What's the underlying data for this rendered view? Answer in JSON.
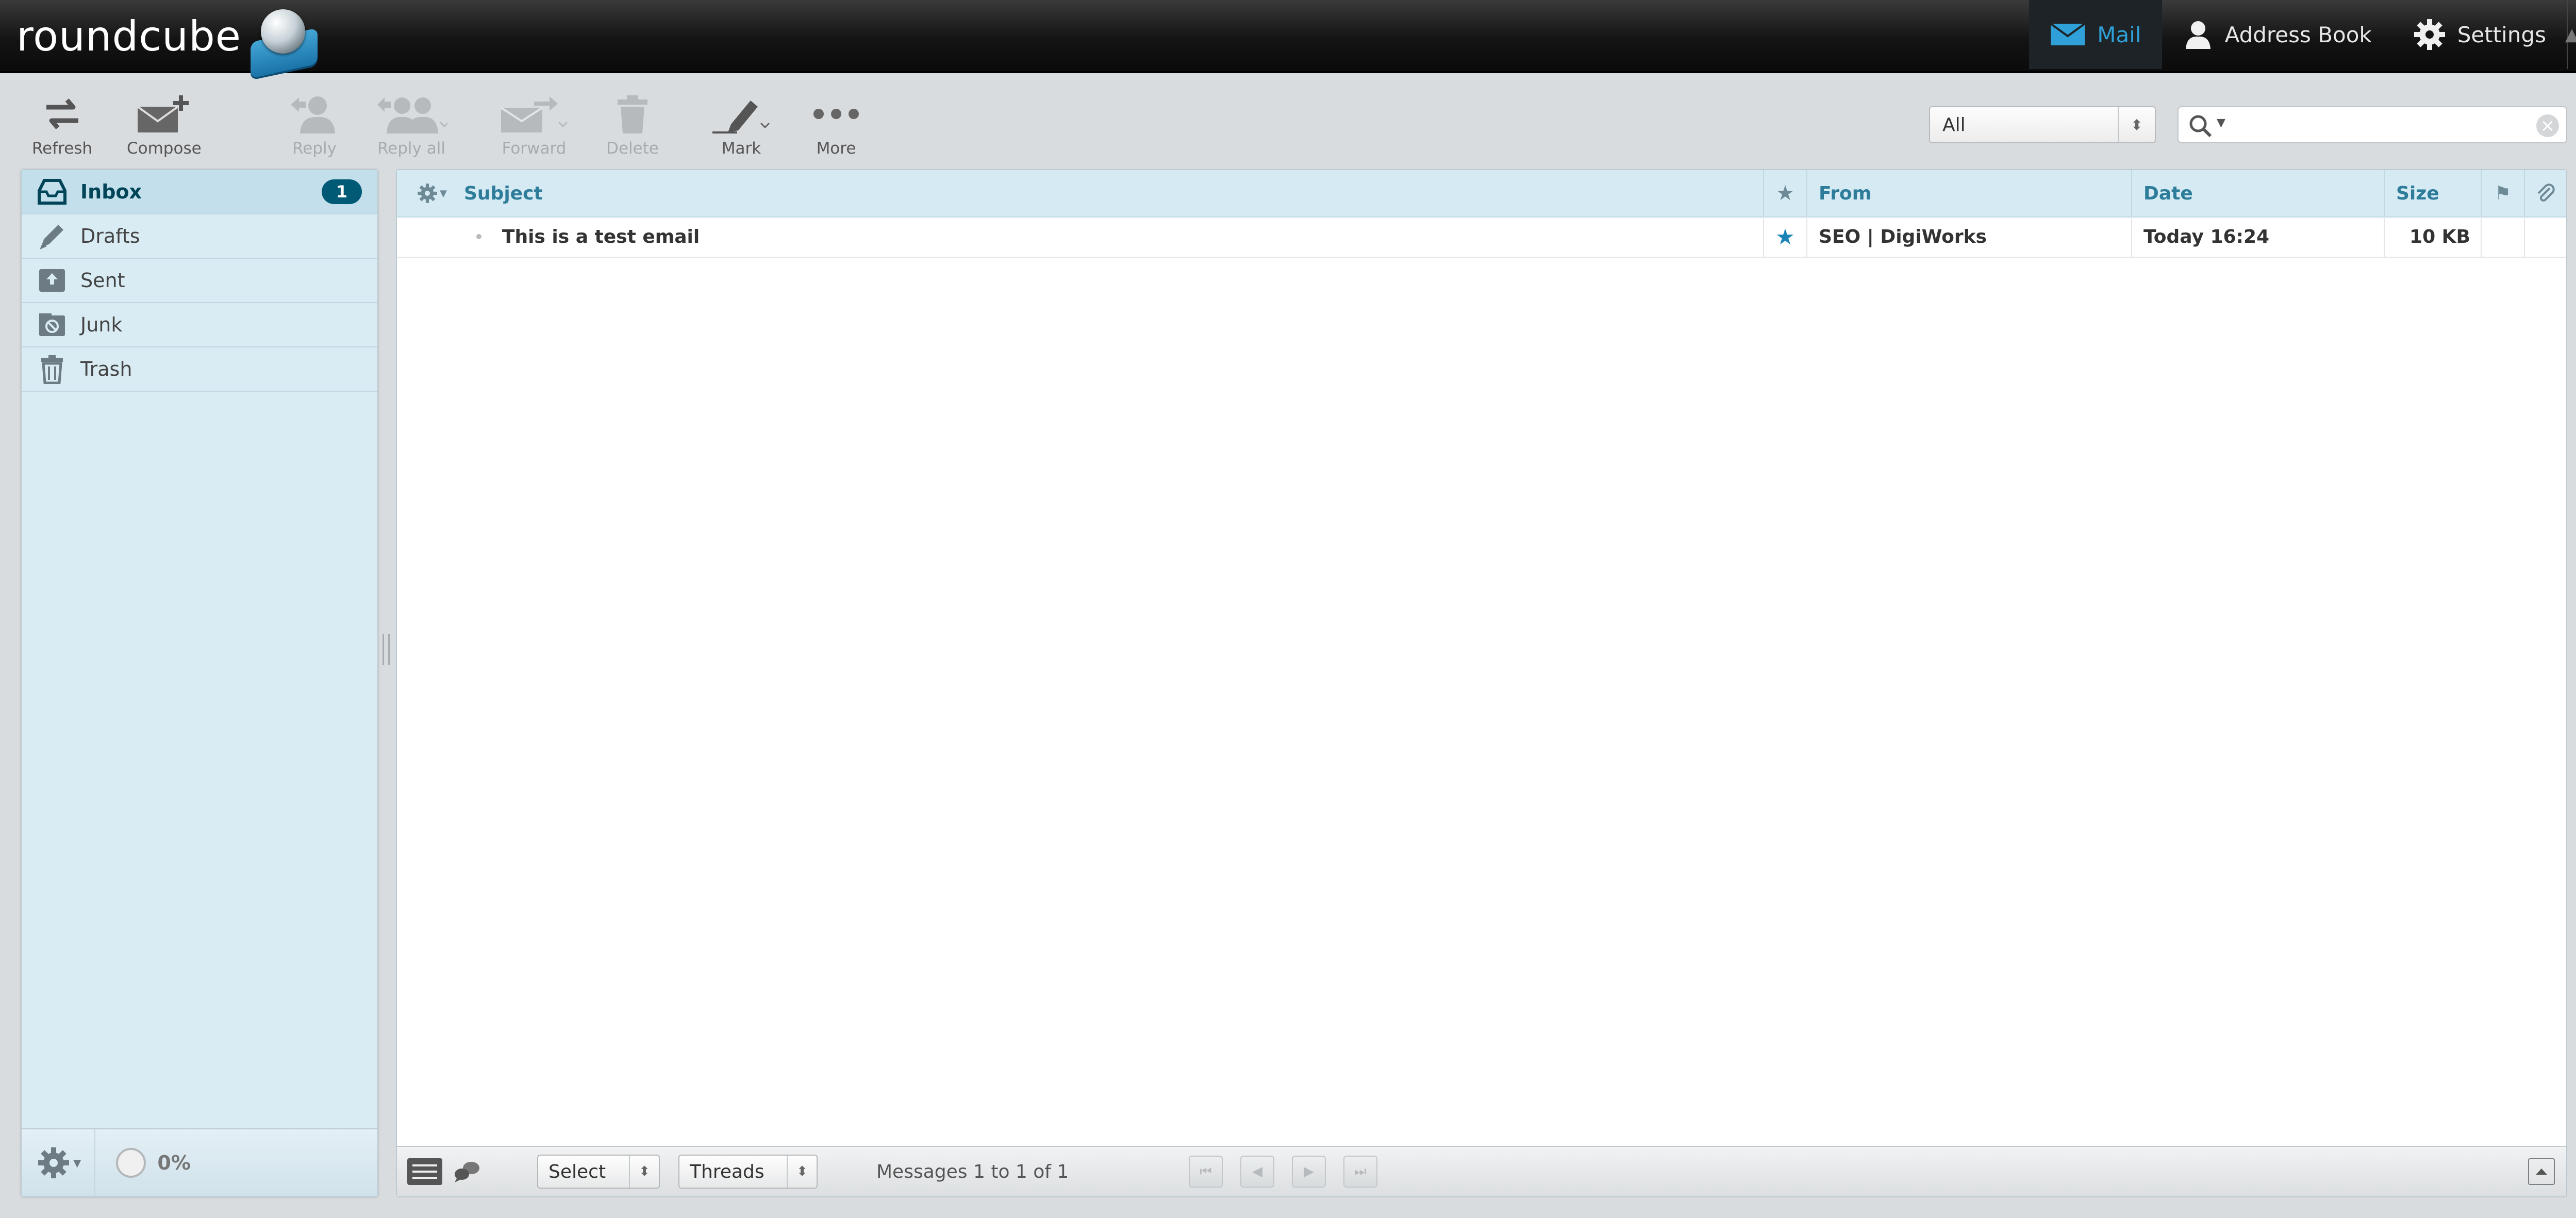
{
  "app": {
    "logo_text": "roundcube"
  },
  "topnav": {
    "mail": "Mail",
    "address_book": "Address Book",
    "settings": "Settings",
    "overflow": "▲"
  },
  "toolbar": {
    "refresh": "Refresh",
    "compose": "Compose",
    "reply": "Reply",
    "reply_all": "Reply all",
    "forward": "Forward",
    "delete": "Delete",
    "mark": "Mark",
    "more": "More"
  },
  "filter": {
    "selected": "All"
  },
  "search": {
    "value": ""
  },
  "folders": [
    {
      "label": "Inbox",
      "icon": "inbox-icon",
      "unread": "1",
      "selected": true
    },
    {
      "label": "Drafts",
      "icon": "pencil-icon"
    },
    {
      "label": "Sent",
      "icon": "sent-icon"
    },
    {
      "label": "Junk",
      "icon": "junk-icon"
    },
    {
      "label": "Trash",
      "icon": "trash-icon"
    }
  ],
  "quota": {
    "text": "0%"
  },
  "list": {
    "columns": {
      "subject": "Subject",
      "from": "From",
      "date": "Date",
      "size": "Size"
    },
    "messages": [
      {
        "subject": "This is a test email",
        "from": "SEO | DigiWorks",
        "date": "Today 16:24",
        "size": "10 KB",
        "flagged_star": true
      }
    ]
  },
  "footer": {
    "select": "Select",
    "threads": "Threads",
    "count": "Messages 1 to 1 of 1"
  },
  "colors": {
    "accent": "#2fa0d8",
    "badge": "#005a75",
    "header_text": "#2c7c9a",
    "panel_bg": "#d9ecf4"
  }
}
